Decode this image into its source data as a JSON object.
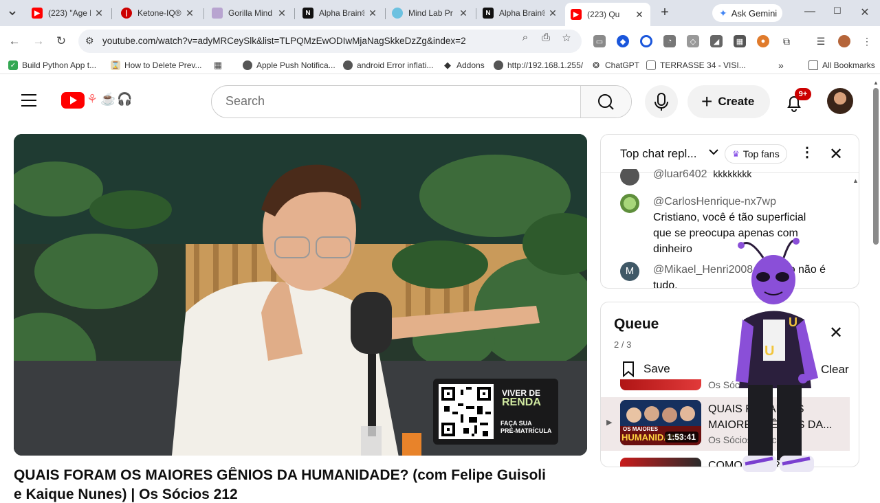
{
  "browser": {
    "tabs": [
      {
        "title": "(223) \"Age R",
        "favicon": "youtube-icon",
        "color": "#ff0000"
      },
      {
        "title": "Ketone-IQ®",
        "favicon": "ketone-icon",
        "color": "#cc0000"
      },
      {
        "title": "Gorilla Mind",
        "favicon": "gorilla-icon",
        "color": "#7c4a9e"
      },
      {
        "title": "Alpha Brain®",
        "favicon": "onnit-icon",
        "color": "#111111"
      },
      {
        "title": "Mind Lab Pr",
        "favicon": "mindlab-icon",
        "color": "#3aa0c8"
      },
      {
        "title": "Alpha Brain®",
        "favicon": "onnit-icon",
        "color": "#111111"
      },
      {
        "title": "(223) Qu",
        "favicon": "youtube-icon",
        "color": "#ff0000",
        "active": true
      }
    ],
    "gemini_label": "Ask Gemini",
    "url": "youtube.com/watch?v=adyMRCeySlk&list=TLPQMzEwODIwMjaNagSkkeDzZg&index=2",
    "bookmarks": [
      {
        "label": "Build Python App t...",
        "icon": "check-icon",
        "color": "#34a853"
      },
      {
        "label": "How to Delete Prev...",
        "icon": "hourglass-icon",
        "color": "#e8d9b5"
      },
      {
        "label": "",
        "icon": "apps-grid-icon",
        "color": "#444444"
      },
      {
        "label": "Apple Push Notifica...",
        "icon": "globe-icon",
        "color": "#444444"
      },
      {
        "label": "android Error inflati...",
        "icon": "globe-icon",
        "color": "#444444"
      },
      {
        "label": "Addons",
        "icon": "addons-icon",
        "color": "#444444"
      },
      {
        "label": "http://192.168.1.255/",
        "icon": "globe-icon",
        "color": "#444444"
      },
      {
        "label": "ChatGPT",
        "icon": "chatgpt-icon",
        "color": "#444444"
      },
      {
        "label": "TERRASSE 34 - VISI...",
        "icon": "document-icon",
        "color": "#666666"
      }
    ],
    "more_bookmarks": "»",
    "all_bookmarks": "All Bookmarks"
  },
  "youtube": {
    "search_placeholder": "Search",
    "create_label": "Create",
    "notification_count": "9+",
    "video": {
      "title_line1": "QUAIS FORAM OS MAIORES GÊNIOS DA HUMANIDADE? (com Felipe Guisoli",
      "title_line2": "e Kaique Nunes) | Os Sócios 212",
      "overlay_brand_top": "VIVER DE",
      "overlay_brand_bottom": "RENDA",
      "overlay_cta_line1": "FAÇA SUA",
      "overlay_cta_line2": "PRÉ-MATRÍCULA"
    },
    "chat": {
      "title": "Top chat repl...",
      "top_fans_label": "Top fans",
      "messages": [
        {
          "author": "@luar6402",
          "text": "kkkkkkkk",
          "avatar_color": "#555555"
        },
        {
          "author": "@CarlosHenrique-nx7wp",
          "text": "Cristiano, você é tão superficial que se preocupa apenas com dinheiro",
          "avatar_color": "#7fae5a"
        },
        {
          "author": "@Mikael_Henri2008",
          "text": "dinheiro não é tudo.",
          "avatar_color": "#3f5866",
          "initial": "M"
        }
      ]
    },
    "queue": {
      "title": "Queue",
      "position": "2 / 3",
      "save_label": "Save",
      "clear_label": "Clear",
      "items": [
        {
          "title": "",
          "channel": "Os Sócios Podcast"
        },
        {
          "title": "QUAIS FORAM OS MAIORES GÊNIOS DA...",
          "channel": "Os Sócios Podcast",
          "duration": "1:53:41",
          "thumb_text_top": "OS MAIORES",
          "thumb_text_bottom": "HUMANIDADE",
          "current": true
        },
        {
          "title": "COMO FALAR",
          "channel": ""
        }
      ]
    }
  }
}
